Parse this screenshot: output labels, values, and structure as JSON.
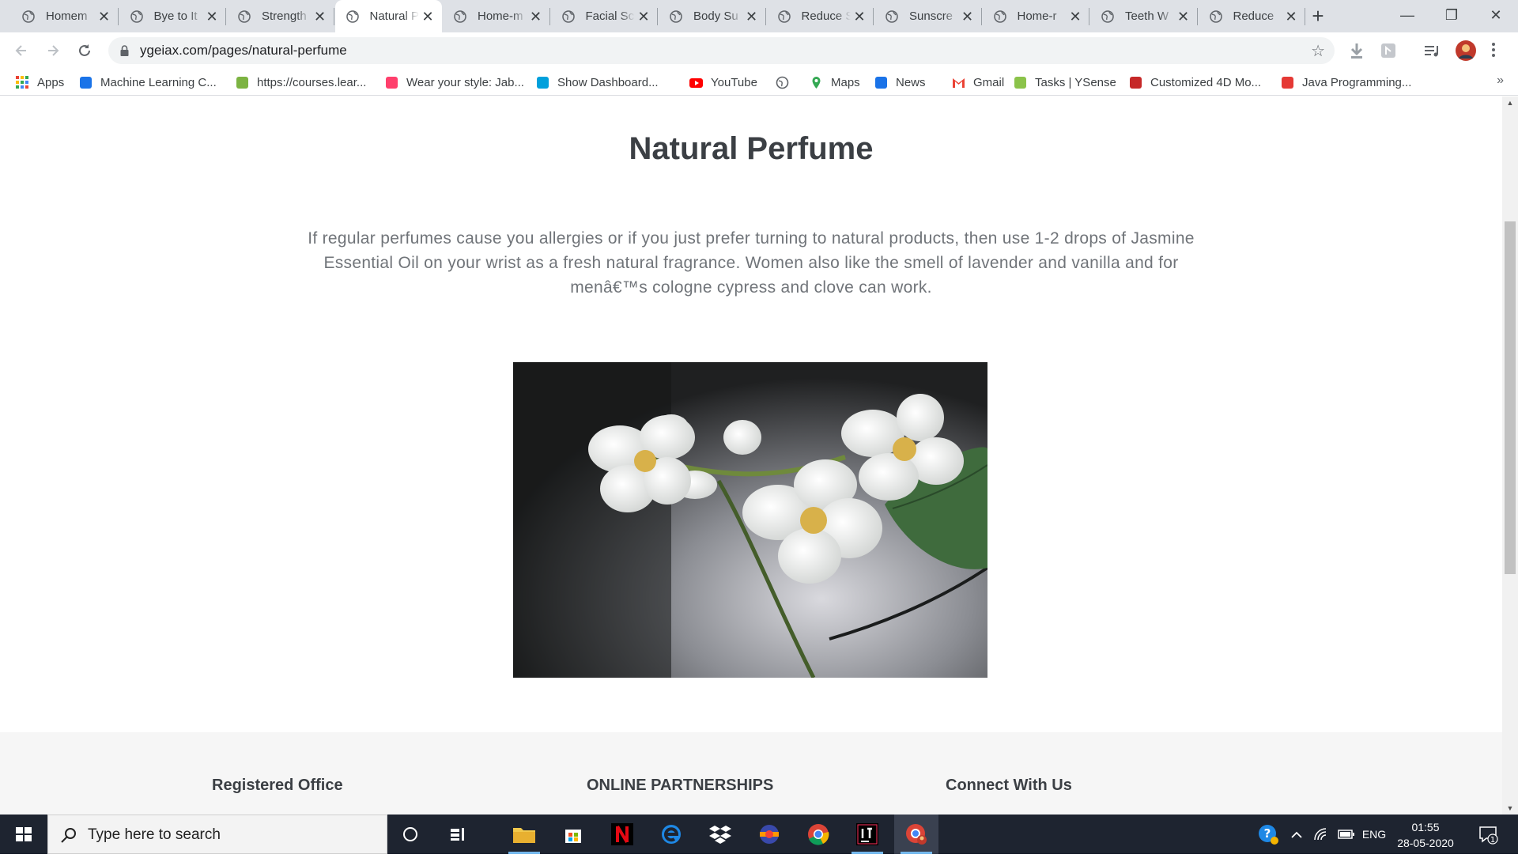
{
  "browser": {
    "tabs": [
      {
        "title": "Homem",
        "active": false
      },
      {
        "title": "Bye to It",
        "active": false
      },
      {
        "title": "Strength",
        "active": false
      },
      {
        "title": "Natural P",
        "active": true
      },
      {
        "title": "Home-m",
        "active": false
      },
      {
        "title": "Facial Sc",
        "active": false
      },
      {
        "title": "Body Su",
        "active": false
      },
      {
        "title": "Reduce S",
        "active": false
      },
      {
        "title": "Sunscre",
        "active": false
      },
      {
        "title": "Home-r",
        "active": false
      },
      {
        "title": "Teeth W",
        "active": false
      },
      {
        "title": "Reduce ",
        "active": false
      }
    ],
    "new_tab_label": "+",
    "window_controls": {
      "minimize": "—",
      "restore": "❐",
      "close": "✕"
    },
    "address": {
      "url": "ygeiax.com/pages/natural-perfume"
    },
    "bookmarks": [
      {
        "label": "Apps",
        "icon": "apps-grid-icon"
      },
      {
        "label": "Machine Learning C...",
        "icon": "ml-course-icon"
      },
      {
        "label": "https://courses.lear...",
        "icon": "courses-icon"
      },
      {
        "label": "Wear your style: Jab...",
        "icon": "myntra-icon"
      },
      {
        "label": "Show Dashboard...",
        "icon": "dashboard-icon"
      },
      {
        "label": "YouTube",
        "icon": "youtube-icon"
      },
      {
        "label": "",
        "icon": "globe-icon"
      },
      {
        "label": "Maps",
        "icon": "maps-icon"
      },
      {
        "label": "News",
        "icon": "news-icon"
      },
      {
        "label": "Gmail",
        "icon": "gmail-icon"
      },
      {
        "label": "Tasks | YSense",
        "icon": "ysense-icon"
      },
      {
        "label": "Customized 4D Mo...",
        "icon": "customized-icon"
      },
      {
        "label": "Java Programming...",
        "icon": "java-icon"
      }
    ],
    "bookmarks_overflow": "»"
  },
  "page": {
    "title": "Natural Perfume",
    "body": "If regular perfumes cause you allergies or if you just prefer turning to natural products, then use 1-2 drops of Jasmine Essential Oil on your wrist as a fresh natural fragrance. Women also like the smell of lavender and vanilla and for menâ€™s cologne cypress and clove can work.",
    "image_subject": "white jasmine flowers",
    "footer": {
      "headings": [
        "Registered Office",
        "ONLINE PARTNERSHIPS",
        "Connect With Us"
      ]
    }
  },
  "taskbar": {
    "search_placeholder": "Type here to search",
    "apps": [
      "cortana-icon",
      "task-view-icon",
      "file-explorer-icon",
      "store-icon",
      "netflix-icon",
      "edge-icon",
      "dropbox-icon",
      "unknown-app-icon",
      "chrome-icon",
      "intellij-icon",
      "chrome-profile-icon"
    ],
    "tray": {
      "language": "ENG"
    },
    "clock": {
      "time": "01:55",
      "date": "28-05-2020"
    },
    "notification_count": "1"
  },
  "colors": {
    "tab_strip": "#dee1e6",
    "title_text": "#3b3f44",
    "body_text": "#707479",
    "footer_bg": "#f6f6f6",
    "taskbar": "#1e2430"
  }
}
